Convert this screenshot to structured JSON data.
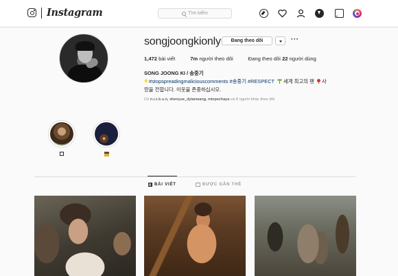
{
  "nav": {
    "brand": "Instagram",
    "search_placeholder": "Tìm kiếm",
    "icons": [
      "instagram-glyph-icon",
      "compass-icon",
      "heart-icon",
      "user-icon",
      "download-icon",
      "phone-icon",
      "instagram-ring-icon"
    ]
  },
  "profile": {
    "username": "songjoongkionly",
    "follow_button": "Đang theo dõi",
    "more": "···",
    "stats": {
      "posts_count": "1,472",
      "posts_label": "bài viết",
      "followers_count": "7m",
      "followers_label": "người theo dõi",
      "following_prefix": "Đang theo dõi",
      "following_count": "22",
      "following_label": "người dùng"
    },
    "full_name": "SONG JOONG KI / 송중기",
    "bio_line1_tags": "#stopspreadingmaliciouscomments #송중기 #RESPECT",
    "bio_line1_text": "세계 최고의 팬",
    "bio_line1_tail": "사",
    "bio_line2": "랑을 전합니다. 이웃을 존중하십시오.",
    "followed_by_prefix": "Có",
    "followed_by_names": "n.i.c.k.u.n, shenyue_dylanwang, minpechaya",
    "followed_by_suffix": "và 8 người khác theo dõi"
  },
  "highlights": [
    {
      "caption_glyph": "box"
    },
    {
      "caption_glyph": "house"
    }
  ],
  "tabs": {
    "posts": "BÀI VIẾT",
    "tagged": "ĐƯỢC GẮN THẺ"
  },
  "posts": [
    {
      "kind": "photo"
    },
    {
      "kind": "photo"
    },
    {
      "kind": "photo"
    }
  ],
  "colors": {
    "hashtag": "#003569",
    "muted": "#8e8e8e",
    "border": "#dbdbdb",
    "background": "#fafafa"
  }
}
